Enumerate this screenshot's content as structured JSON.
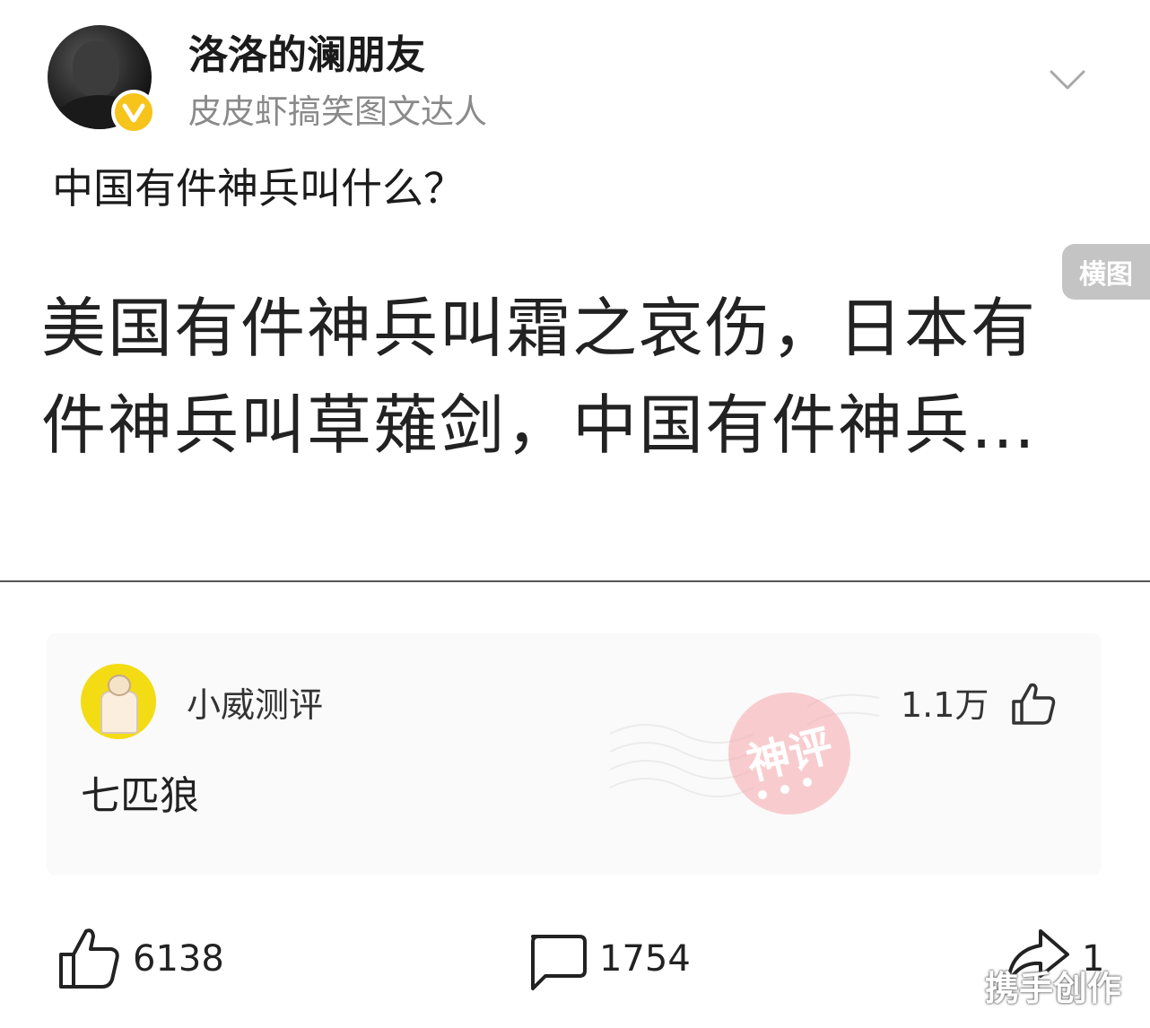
{
  "post": {
    "author_name": "洛洛的澜朋友",
    "author_title": "皮皮虾搞笑图文达人",
    "title": "中国有件神兵叫什么？",
    "image_tag": "横图",
    "image_text": "美国有件神兵叫霜之哀伤，日本有件神兵叫草薙剑，中国有件神兵…"
  },
  "top_comment": {
    "user_name": "小威测评",
    "like_count": "1.1万",
    "text": "七匹狼",
    "stamp_label": "神评"
  },
  "actions": {
    "like_count": "6138",
    "comment_count": "1754",
    "share_count": "1"
  },
  "watermark": "携手创作",
  "colors": {
    "verify_badge": "#f6c41b",
    "commenter_avatar_bg": "#f3dc14",
    "stamp": "#f5a5ab"
  }
}
